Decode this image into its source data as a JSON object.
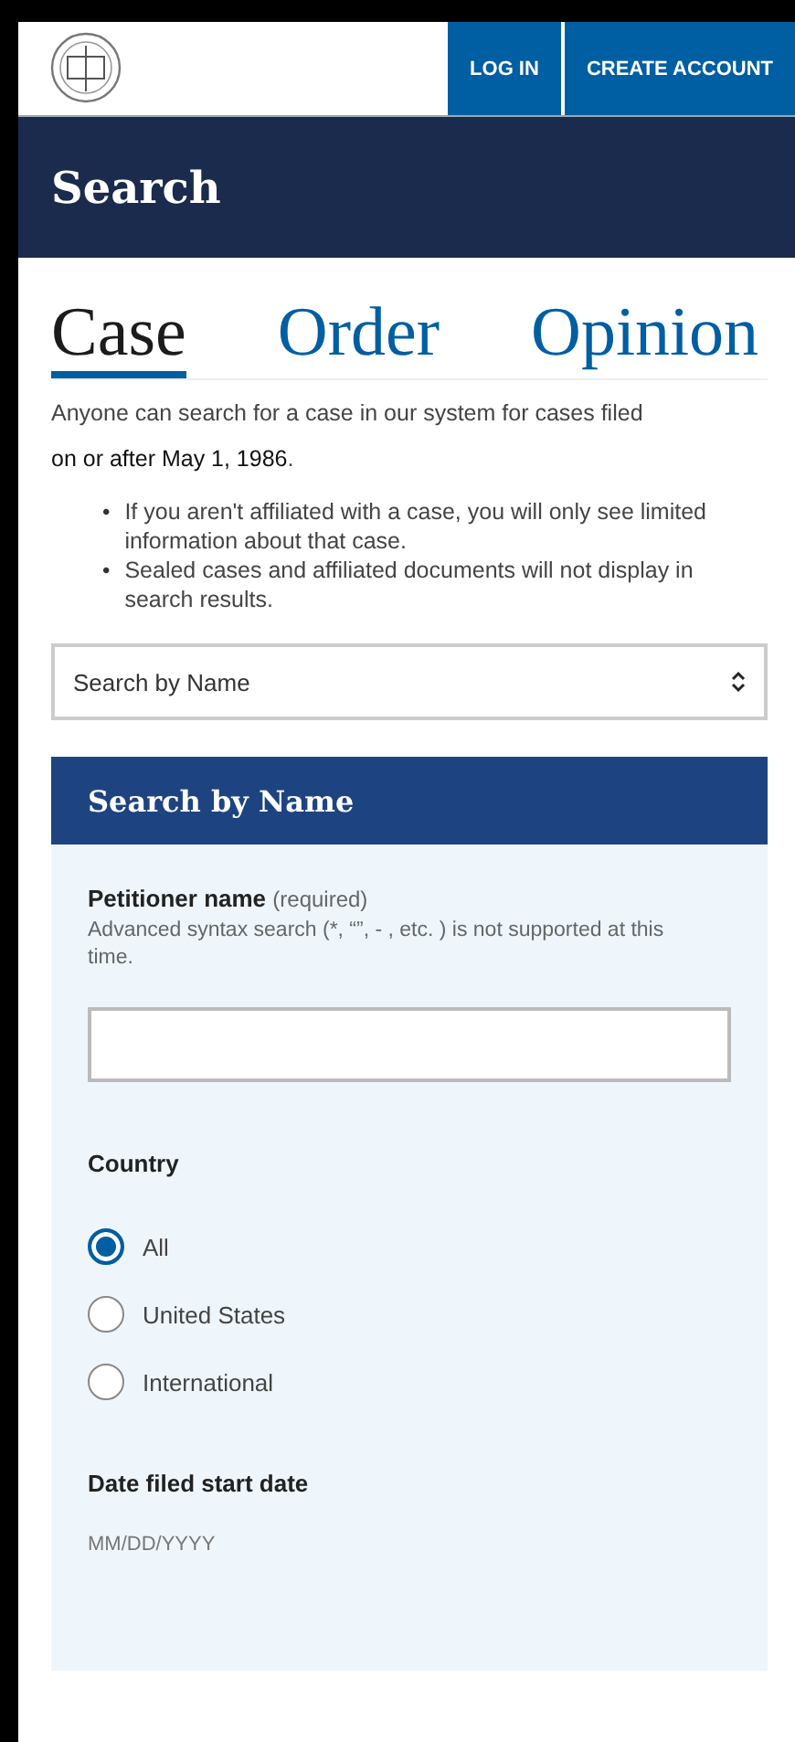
{
  "header": {
    "nav_buttons": [
      "LOG IN",
      "CREATE ACCOUNT"
    ]
  },
  "title": "Search",
  "tabs": [
    {
      "label": "Case",
      "selected": true
    },
    {
      "label": "Order",
      "selected": false
    },
    {
      "label": "Opinion",
      "selected": false
    }
  ],
  "intro": "Anyone can search for a case in our system for cases filed **on or after May 1, 1986**.",
  "notes": [
    {
      "marker": "•",
      "text": "If you aren't affiliated with a case, you will only see limited information about that case."
    },
    {
      "marker": "•",
      "text": "Sealed cases and affiliated documents will not display in search results."
    }
  ],
  "search_type": {
    "value": "Search by Name"
  },
  "panel": {
    "title": "Search by Name",
    "petitioner": {
      "label": "Petitioner name",
      "qualifier": "(required)",
      "hint": "Advanced syntax search (*, “”, - , etc. ) is not supported at this time."
    },
    "country": {
      "label": "Country",
      "options": [
        {
          "label": "All",
          "selected": true
        },
        {
          "label": "United States",
          "selected": false
        },
        {
          "label": "International",
          "selected": false
        }
      ]
    },
    "start_date": {
      "label": "Date filed start date",
      "hint": "MM/DD/YYYY"
    }
  }
}
